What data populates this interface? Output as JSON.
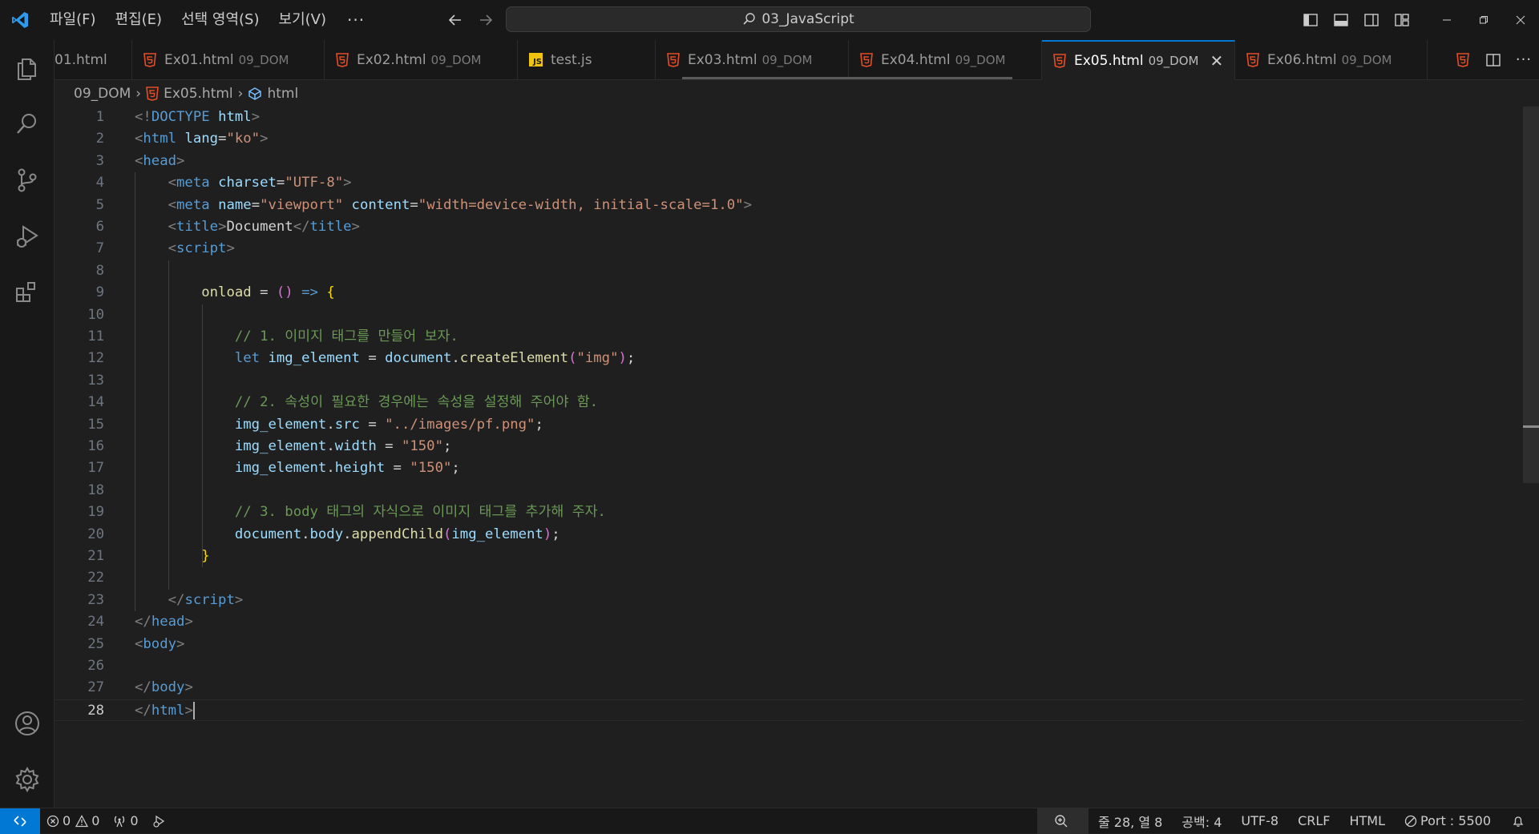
{
  "menu": {
    "items": [
      "파일(F)",
      "편집(E)",
      "선택 영역(S)",
      "보기(V)"
    ],
    "more": "···"
  },
  "command_center": {
    "label": "03_JavaScript"
  },
  "tabs": [
    {
      "name": "01.html",
      "desc": "",
      "type": "html"
    },
    {
      "name": "Ex01.html",
      "desc": "09_DOM",
      "type": "html"
    },
    {
      "name": "Ex02.html",
      "desc": "09_DOM",
      "type": "html"
    },
    {
      "name": "test.js",
      "desc": "",
      "type": "js"
    },
    {
      "name": "Ex03.html",
      "desc": "09_DOM",
      "type": "html"
    },
    {
      "name": "Ex04.html",
      "desc": "09_DOM",
      "type": "html"
    },
    {
      "name": "Ex05.html",
      "desc": "09_DOM",
      "type": "html",
      "active": true
    },
    {
      "name": "Ex06.html",
      "desc": "09_DOM",
      "type": "html"
    }
  ],
  "breadcrumb": {
    "folder": "09_DOM",
    "file": "Ex05.html",
    "symbol": "html"
  },
  "editor": {
    "current_line": 28,
    "lines": [
      [
        [
          "t-punc",
          "<!"
        ],
        [
          "t-tag",
          "DOCTYPE"
        ],
        [
          "t-text",
          " "
        ],
        [
          "t-attr",
          "html"
        ],
        [
          "t-punc",
          ">"
        ]
      ],
      [
        [
          "t-punc",
          "<"
        ],
        [
          "t-tag",
          "html"
        ],
        [
          "t-text",
          " "
        ],
        [
          "t-attr",
          "lang"
        ],
        [
          "t-text",
          "="
        ],
        [
          "t-str",
          "\"ko\""
        ],
        [
          "t-punc",
          ">"
        ]
      ],
      [
        [
          "t-punc",
          "<"
        ],
        [
          "t-tag",
          "head"
        ],
        [
          "t-punc",
          ">"
        ]
      ],
      [
        [
          "t-text",
          "    "
        ],
        [
          "t-punc",
          "<"
        ],
        [
          "t-tag",
          "meta"
        ],
        [
          "t-text",
          " "
        ],
        [
          "t-attr",
          "charset"
        ],
        [
          "t-text",
          "="
        ],
        [
          "t-str",
          "\"UTF-8\""
        ],
        [
          "t-punc",
          ">"
        ]
      ],
      [
        [
          "t-text",
          "    "
        ],
        [
          "t-punc",
          "<"
        ],
        [
          "t-tag",
          "meta"
        ],
        [
          "t-text",
          " "
        ],
        [
          "t-attr",
          "name"
        ],
        [
          "t-text",
          "="
        ],
        [
          "t-str",
          "\"viewport\""
        ],
        [
          "t-text",
          " "
        ],
        [
          "t-attr",
          "content"
        ],
        [
          "t-text",
          "="
        ],
        [
          "t-str",
          "\"width=device-width, initial-scale=1.0\""
        ],
        [
          "t-punc",
          ">"
        ]
      ],
      [
        [
          "t-text",
          "    "
        ],
        [
          "t-punc",
          "<"
        ],
        [
          "t-tag",
          "title"
        ],
        [
          "t-punc",
          ">"
        ],
        [
          "t-text",
          "Document"
        ],
        [
          "t-punc",
          "</"
        ],
        [
          "t-tag",
          "title"
        ],
        [
          "t-punc",
          ">"
        ]
      ],
      [
        [
          "t-text",
          "    "
        ],
        [
          "t-punc",
          "<"
        ],
        [
          "t-tag",
          "script"
        ],
        [
          "t-punc",
          ">"
        ]
      ],
      [],
      [
        [
          "t-text",
          "        "
        ],
        [
          "t-fn",
          "onload"
        ],
        [
          "t-op",
          " = "
        ],
        [
          "t-br2",
          "()"
        ],
        [
          "t-op",
          " "
        ],
        [
          "t-kw",
          "=>"
        ],
        [
          "t-op",
          " "
        ],
        [
          "t-br1",
          "{"
        ]
      ],
      [],
      [
        [
          "t-text",
          "            "
        ],
        [
          "t-cmt",
          "// 1. 이미지 태그를 만들어 보자."
        ]
      ],
      [
        [
          "t-text",
          "            "
        ],
        [
          "t-kw",
          "let"
        ],
        [
          "t-op",
          " "
        ],
        [
          "t-var",
          "img_element"
        ],
        [
          "t-op",
          " = "
        ],
        [
          "t-var",
          "document"
        ],
        [
          "t-op",
          "."
        ],
        [
          "t-fn",
          "createElement"
        ],
        [
          "t-br2",
          "("
        ],
        [
          "t-str",
          "\"img\""
        ],
        [
          "t-br2",
          ")"
        ],
        [
          "t-op",
          ";"
        ]
      ],
      [],
      [
        [
          "t-text",
          "            "
        ],
        [
          "t-cmt",
          "// 2. 속성이 필요한 경우에는 속성을 설정해 주어야 함."
        ]
      ],
      [
        [
          "t-text",
          "            "
        ],
        [
          "t-var",
          "img_element"
        ],
        [
          "t-op",
          "."
        ],
        [
          "t-var",
          "src"
        ],
        [
          "t-op",
          " = "
        ],
        [
          "t-str",
          "\"../images/pf.png\""
        ],
        [
          "t-op",
          ";"
        ]
      ],
      [
        [
          "t-text",
          "            "
        ],
        [
          "t-var",
          "img_element"
        ],
        [
          "t-op",
          "."
        ],
        [
          "t-var",
          "width"
        ],
        [
          "t-op",
          " = "
        ],
        [
          "t-str",
          "\"150\""
        ],
        [
          "t-op",
          ";"
        ]
      ],
      [
        [
          "t-text",
          "            "
        ],
        [
          "t-var",
          "img_element"
        ],
        [
          "t-op",
          "."
        ],
        [
          "t-var",
          "height"
        ],
        [
          "t-op",
          " = "
        ],
        [
          "t-str",
          "\"150\""
        ],
        [
          "t-op",
          ";"
        ]
      ],
      [],
      [
        [
          "t-text",
          "            "
        ],
        [
          "t-cmt",
          "// 3. body 태그의 자식으로 이미지 태그를 추가해 주자."
        ]
      ],
      [
        [
          "t-text",
          "            "
        ],
        [
          "t-var",
          "document"
        ],
        [
          "t-op",
          "."
        ],
        [
          "t-var",
          "body"
        ],
        [
          "t-op",
          "."
        ],
        [
          "t-fn",
          "appendChild"
        ],
        [
          "t-br2",
          "("
        ],
        [
          "t-var",
          "img_element"
        ],
        [
          "t-br2",
          ")"
        ],
        [
          "t-op",
          ";"
        ]
      ],
      [
        [
          "t-text",
          "        "
        ],
        [
          "t-br1",
          "}"
        ]
      ],
      [],
      [
        [
          "t-text",
          "    "
        ],
        [
          "t-punc",
          "</"
        ],
        [
          "t-tag",
          "script"
        ],
        [
          "t-punc",
          ">"
        ]
      ],
      [
        [
          "t-punc",
          "</"
        ],
        [
          "t-tag",
          "head"
        ],
        [
          "t-punc",
          ">"
        ]
      ],
      [
        [
          "t-punc",
          "<"
        ],
        [
          "t-tag",
          "body"
        ],
        [
          "t-punc",
          ">"
        ]
      ],
      [],
      [
        [
          "t-punc",
          "</"
        ],
        [
          "t-tag",
          "body"
        ],
        [
          "t-punc",
          ">"
        ]
      ],
      [
        [
          "t-punc",
          "</"
        ],
        [
          "t-tag",
          "html"
        ],
        [
          "t-punc",
          ">"
        ]
      ]
    ]
  },
  "status": {
    "errors": "0",
    "warnings": "0",
    "ports": "0",
    "position": "줄 28, 열 8",
    "indent": "공백: 4",
    "encoding": "UTF-8",
    "eol": "CRLF",
    "language": "HTML",
    "port": "Port : 5500"
  },
  "colors": {
    "accent": "#0078d4",
    "html_icon": "#e44d26",
    "js_icon": "#f1c40f"
  }
}
